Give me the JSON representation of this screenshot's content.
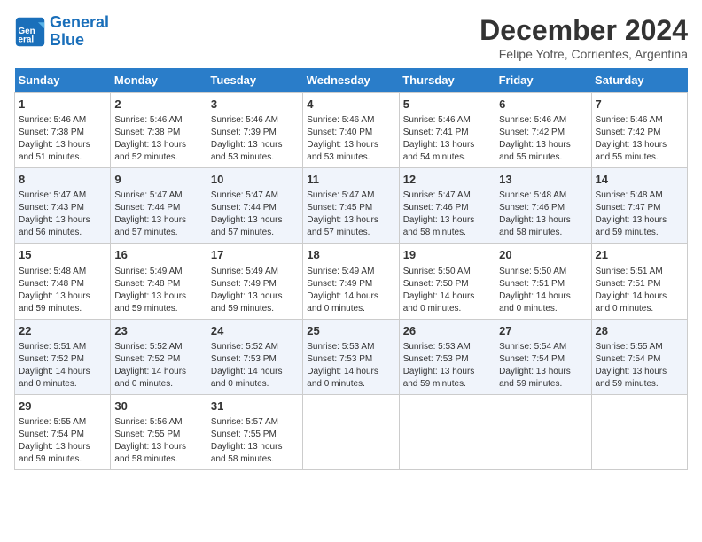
{
  "logo": {
    "line1": "General",
    "line2": "Blue"
  },
  "title": "December 2024",
  "subtitle": "Felipe Yofre, Corrientes, Argentina",
  "days_of_week": [
    "Sunday",
    "Monday",
    "Tuesday",
    "Wednesday",
    "Thursday",
    "Friday",
    "Saturday"
  ],
  "weeks": [
    [
      {
        "day": 1,
        "info": "Sunrise: 5:46 AM\nSunset: 7:38 PM\nDaylight: 13 hours\nand 51 minutes."
      },
      {
        "day": 2,
        "info": "Sunrise: 5:46 AM\nSunset: 7:38 PM\nDaylight: 13 hours\nand 52 minutes."
      },
      {
        "day": 3,
        "info": "Sunrise: 5:46 AM\nSunset: 7:39 PM\nDaylight: 13 hours\nand 53 minutes."
      },
      {
        "day": 4,
        "info": "Sunrise: 5:46 AM\nSunset: 7:40 PM\nDaylight: 13 hours\nand 53 minutes."
      },
      {
        "day": 5,
        "info": "Sunrise: 5:46 AM\nSunset: 7:41 PM\nDaylight: 13 hours\nand 54 minutes."
      },
      {
        "day": 6,
        "info": "Sunrise: 5:46 AM\nSunset: 7:42 PM\nDaylight: 13 hours\nand 55 minutes."
      },
      {
        "day": 7,
        "info": "Sunrise: 5:46 AM\nSunset: 7:42 PM\nDaylight: 13 hours\nand 55 minutes."
      }
    ],
    [
      {
        "day": 8,
        "info": "Sunrise: 5:47 AM\nSunset: 7:43 PM\nDaylight: 13 hours\nand 56 minutes."
      },
      {
        "day": 9,
        "info": "Sunrise: 5:47 AM\nSunset: 7:44 PM\nDaylight: 13 hours\nand 57 minutes."
      },
      {
        "day": 10,
        "info": "Sunrise: 5:47 AM\nSunset: 7:44 PM\nDaylight: 13 hours\nand 57 minutes."
      },
      {
        "day": 11,
        "info": "Sunrise: 5:47 AM\nSunset: 7:45 PM\nDaylight: 13 hours\nand 57 minutes."
      },
      {
        "day": 12,
        "info": "Sunrise: 5:47 AM\nSunset: 7:46 PM\nDaylight: 13 hours\nand 58 minutes."
      },
      {
        "day": 13,
        "info": "Sunrise: 5:48 AM\nSunset: 7:46 PM\nDaylight: 13 hours\nand 58 minutes."
      },
      {
        "day": 14,
        "info": "Sunrise: 5:48 AM\nSunset: 7:47 PM\nDaylight: 13 hours\nand 59 minutes."
      }
    ],
    [
      {
        "day": 15,
        "info": "Sunrise: 5:48 AM\nSunset: 7:48 PM\nDaylight: 13 hours\nand 59 minutes."
      },
      {
        "day": 16,
        "info": "Sunrise: 5:49 AM\nSunset: 7:48 PM\nDaylight: 13 hours\nand 59 minutes."
      },
      {
        "day": 17,
        "info": "Sunrise: 5:49 AM\nSunset: 7:49 PM\nDaylight: 13 hours\nand 59 minutes."
      },
      {
        "day": 18,
        "info": "Sunrise: 5:49 AM\nSunset: 7:49 PM\nDaylight: 14 hours\nand 0 minutes."
      },
      {
        "day": 19,
        "info": "Sunrise: 5:50 AM\nSunset: 7:50 PM\nDaylight: 14 hours\nand 0 minutes."
      },
      {
        "day": 20,
        "info": "Sunrise: 5:50 AM\nSunset: 7:51 PM\nDaylight: 14 hours\nand 0 minutes."
      },
      {
        "day": 21,
        "info": "Sunrise: 5:51 AM\nSunset: 7:51 PM\nDaylight: 14 hours\nand 0 minutes."
      }
    ],
    [
      {
        "day": 22,
        "info": "Sunrise: 5:51 AM\nSunset: 7:52 PM\nDaylight: 14 hours\nand 0 minutes."
      },
      {
        "day": 23,
        "info": "Sunrise: 5:52 AM\nSunset: 7:52 PM\nDaylight: 14 hours\nand 0 minutes."
      },
      {
        "day": 24,
        "info": "Sunrise: 5:52 AM\nSunset: 7:53 PM\nDaylight: 14 hours\nand 0 minutes."
      },
      {
        "day": 25,
        "info": "Sunrise: 5:53 AM\nSunset: 7:53 PM\nDaylight: 14 hours\nand 0 minutes."
      },
      {
        "day": 26,
        "info": "Sunrise: 5:53 AM\nSunset: 7:53 PM\nDaylight: 13 hours\nand 59 minutes."
      },
      {
        "day": 27,
        "info": "Sunrise: 5:54 AM\nSunset: 7:54 PM\nDaylight: 13 hours\nand 59 minutes."
      },
      {
        "day": 28,
        "info": "Sunrise: 5:55 AM\nSunset: 7:54 PM\nDaylight: 13 hours\nand 59 minutes."
      }
    ],
    [
      {
        "day": 29,
        "info": "Sunrise: 5:55 AM\nSunset: 7:54 PM\nDaylight: 13 hours\nand 59 minutes."
      },
      {
        "day": 30,
        "info": "Sunrise: 5:56 AM\nSunset: 7:55 PM\nDaylight: 13 hours\nand 58 minutes."
      },
      {
        "day": 31,
        "info": "Sunrise: 5:57 AM\nSunset: 7:55 PM\nDaylight: 13 hours\nand 58 minutes."
      },
      null,
      null,
      null,
      null
    ]
  ]
}
